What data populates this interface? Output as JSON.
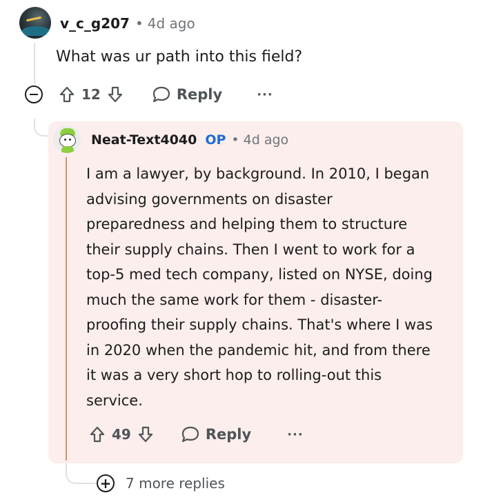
{
  "comment": {
    "username": "v_c_g207",
    "separator": "•",
    "time": "4d ago",
    "text": "What was ur path into this field?",
    "vote_count": "12",
    "reply_label": "Reply",
    "more_label": "···"
  },
  "reply": {
    "username": "Neat-Text4040",
    "badge": "OP",
    "separator": "•",
    "time": "4d ago",
    "lines": [
      "I am a lawyer, by background. In 2010, I began",
      "advising governments on disaster",
      "preparedness and helping them to structure",
      "their supply chains. Then I went to work for a",
      "top-5 med tech company, listed on NYSE, doing",
      "much the same work for them - disaster-",
      "proofing their supply chains. That's where I was",
      "in 2020 when the pandemic hit, and from there",
      "it was a very short hop to rolling-out this",
      "service."
    ],
    "vote_count": "49",
    "reply_label": "Reply",
    "more_label": "···",
    "highlight_color": "#fbeeec",
    "op_color": "#1e6bd6"
  },
  "more_replies": {
    "plus": "+",
    "label": "7 more replies"
  },
  "icons": {
    "collapse": "collapse-minus-icon",
    "upvote": "upvote-arrow-icon",
    "downvote": "downvote-arrow-icon",
    "reply": "speech-bubble-icon",
    "expand": "plus-circle-icon"
  }
}
